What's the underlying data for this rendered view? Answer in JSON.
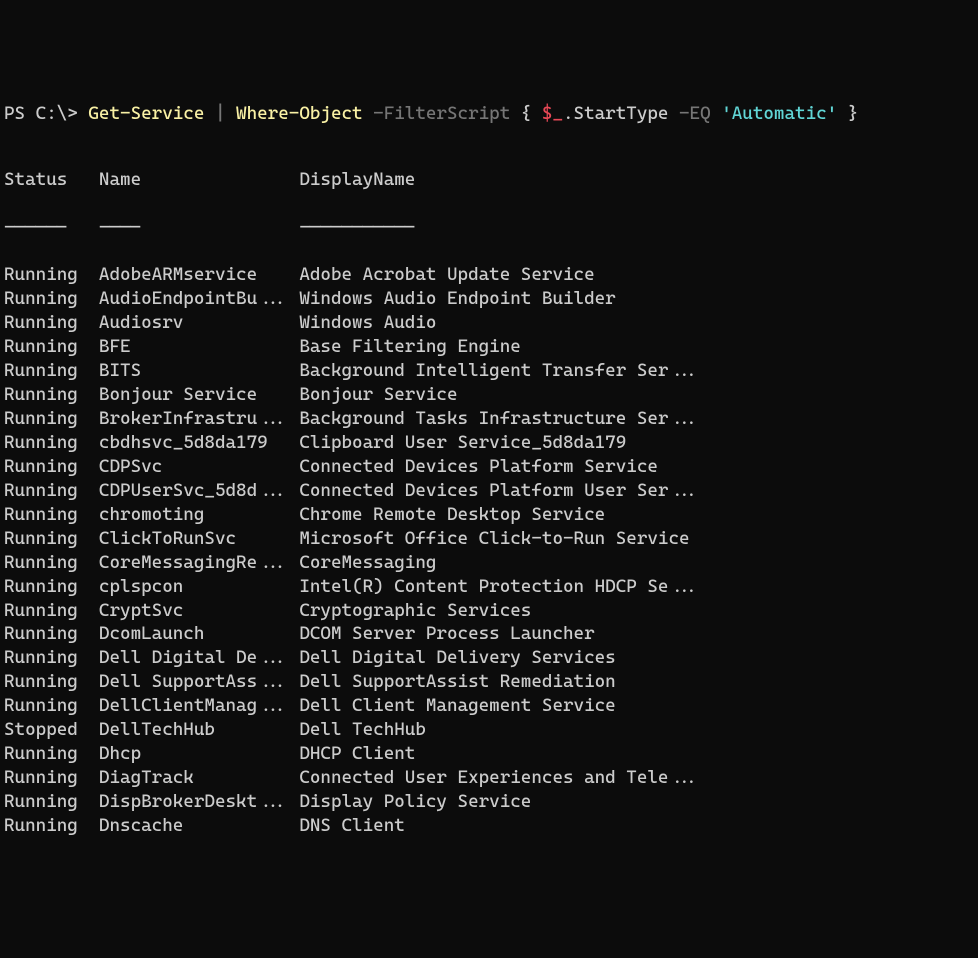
{
  "prompt": {
    "prefix": "PS C:\\> ",
    "cmd1": "Get-Service",
    "pipe1": " | ",
    "cmd2": "Where-Object",
    "param": " -FilterScript ",
    "brace_open": "{ ",
    "var": "$_",
    "dot": ".",
    "prop": "StartType",
    "op": " -EQ ",
    "value": "'Automatic'",
    "brace_close": " }"
  },
  "headers": {
    "status": "Status",
    "name": "Name",
    "displayName": "DisplayName"
  },
  "dividers": {
    "status": "------",
    "name": "----",
    "displayName": "-----------"
  },
  "rows": [
    {
      "status": "Running",
      "name": "AdobeARMservice",
      "displayName": "Adobe Acrobat Update Service"
    },
    {
      "status": "Running",
      "name": "AudioEndpointBu...",
      "displayName": "Windows Audio Endpoint Builder"
    },
    {
      "status": "Running",
      "name": "Audiosrv",
      "displayName": "Windows Audio"
    },
    {
      "status": "Running",
      "name": "BFE",
      "displayName": "Base Filtering Engine"
    },
    {
      "status": "Running",
      "name": "BITS",
      "displayName": "Background Intelligent Transfer Ser..."
    },
    {
      "status": "Running",
      "name": "Bonjour Service",
      "displayName": "Bonjour Service"
    },
    {
      "status": "Running",
      "name": "BrokerInfrastru...",
      "displayName": "Background Tasks Infrastructure Ser..."
    },
    {
      "status": "Running",
      "name": "cbdhsvc_5d8da179",
      "displayName": "Clipboard User Service_5d8da179"
    },
    {
      "status": "Running",
      "name": "CDPSvc",
      "displayName": "Connected Devices Platform Service"
    },
    {
      "status": "Running",
      "name": "CDPUserSvc_5d8d...",
      "displayName": "Connected Devices Platform User Ser..."
    },
    {
      "status": "Running",
      "name": "chromoting",
      "displayName": "Chrome Remote Desktop Service"
    },
    {
      "status": "Running",
      "name": "ClickToRunSvc",
      "displayName": "Microsoft Office Click-to-Run Service"
    },
    {
      "status": "Running",
      "name": "CoreMessagingRe...",
      "displayName": "CoreMessaging"
    },
    {
      "status": "Running",
      "name": "cplspcon",
      "displayName": "Intel(R) Content Protection HDCP Se..."
    },
    {
      "status": "Running",
      "name": "CryptSvc",
      "displayName": "Cryptographic Services"
    },
    {
      "status": "Running",
      "name": "DcomLaunch",
      "displayName": "DCOM Server Process Launcher"
    },
    {
      "status": "Running",
      "name": "Dell Digital De...",
      "displayName": "Dell Digital Delivery Services"
    },
    {
      "status": "Running",
      "name": "Dell SupportAss...",
      "displayName": "Dell SupportAssist Remediation"
    },
    {
      "status": "Running",
      "name": "DellClientManag...",
      "displayName": "Dell Client Management Service"
    },
    {
      "status": "Stopped",
      "name": "DellTechHub",
      "displayName": "Dell TechHub"
    },
    {
      "status": "Running",
      "name": "Dhcp",
      "displayName": "DHCP Client"
    },
    {
      "status": "Running",
      "name": "DiagTrack",
      "displayName": "Connected User Experiences and Tele..."
    },
    {
      "status": "Running",
      "name": "DispBrokerDeskt...",
      "displayName": "Display Policy Service"
    },
    {
      "status": "Running",
      "name": "Dnscache",
      "displayName": "DNS Client"
    }
  ]
}
